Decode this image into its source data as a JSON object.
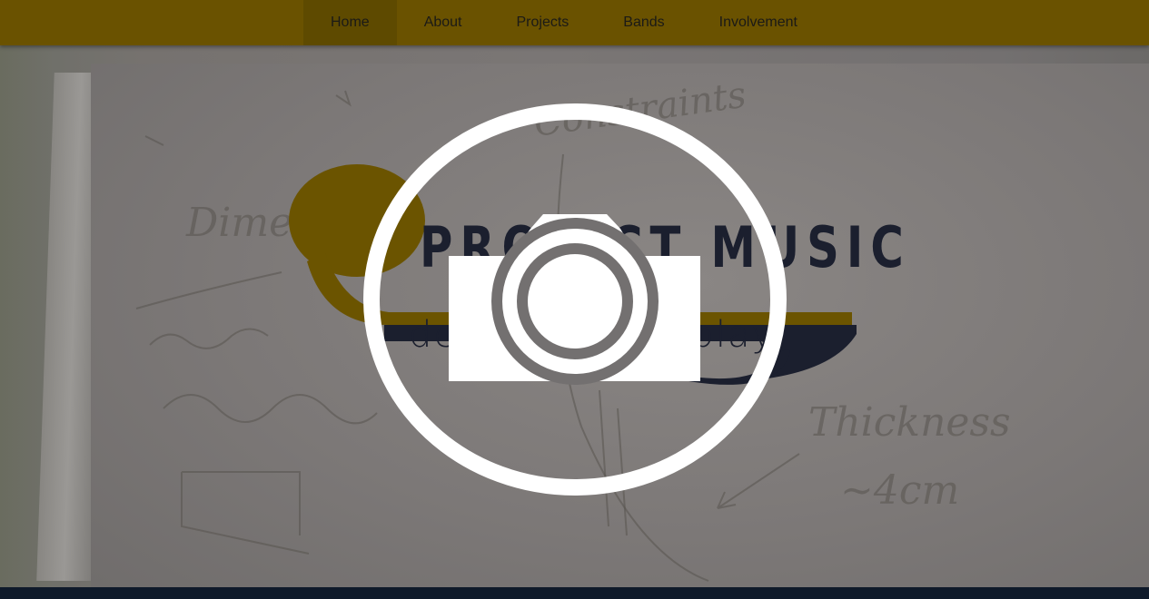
{
  "nav": {
    "items": [
      {
        "label": "Home",
        "active": true
      },
      {
        "label": "About",
        "active": false
      },
      {
        "label": "Projects",
        "active": false
      },
      {
        "label": "Bands",
        "active": false
      },
      {
        "label": "Involvement",
        "active": false
      }
    ]
  },
  "hero": {
    "logo": {
      "title": "PROJECT MUSIC",
      "tagline": "design. build. play."
    },
    "whiteboard_notes": {
      "dimensions": "Dimen",
      "constraints": "Constraints",
      "thickness_line1": "Thickness",
      "thickness_line2": "~4cm"
    },
    "overlay_icon": "camera-icon"
  },
  "colors": {
    "nav_background": "#6a5200",
    "logo_gold": "#6b5400",
    "logo_navy": "#1b1f2e",
    "footer": "#0f1a2a",
    "icon": "#ffffff"
  }
}
